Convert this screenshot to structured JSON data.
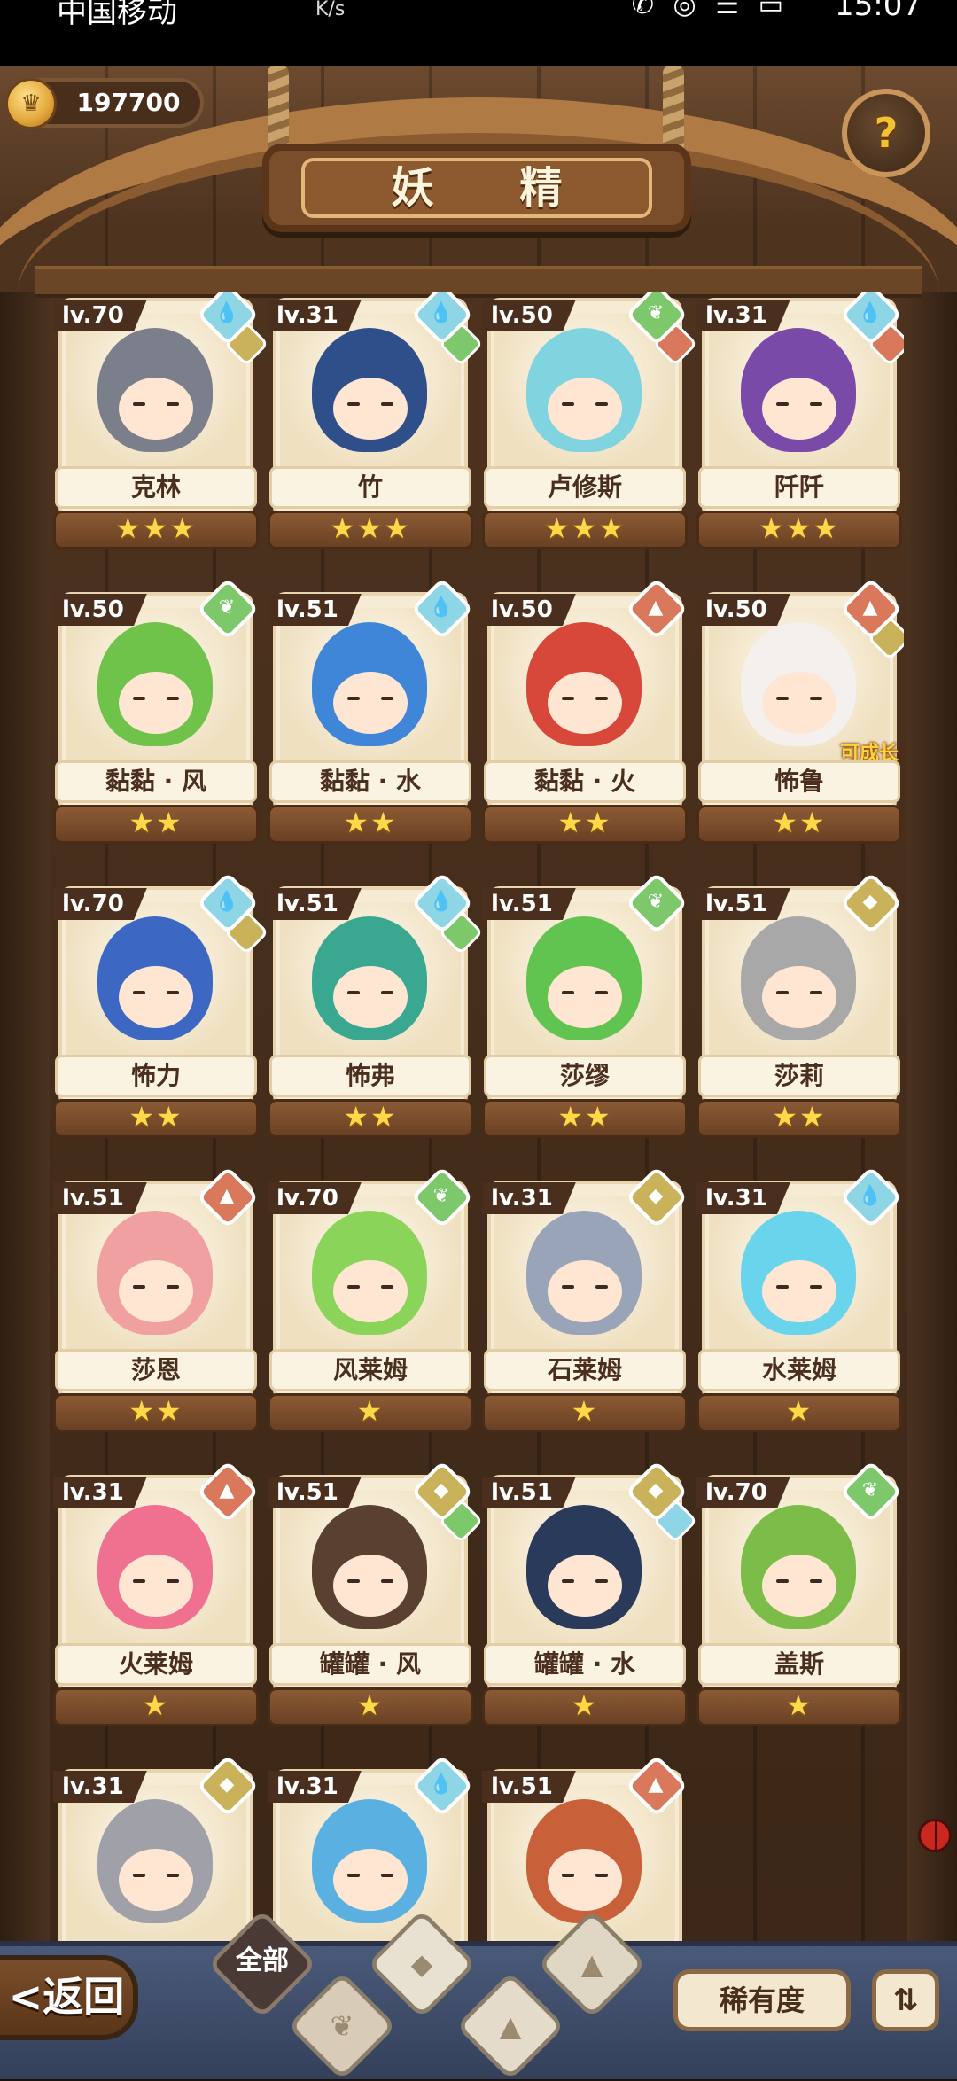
{
  "status_bar": {
    "carrier": "中国移动",
    "network": "K/s",
    "icons": "✆ ◎ ☰ ▭",
    "time": "15:07"
  },
  "header": {
    "coins": "197700",
    "title": "妖 精",
    "help_symbol": "?"
  },
  "elements": {
    "water": {
      "color": "#8ed6e6",
      "icon": "water-drop-icon",
      "symbol": "💧"
    },
    "wind": {
      "color": "#7cc86a",
      "icon": "sprout-icon",
      "symbol": "❦"
    },
    "fire": {
      "color": "#d9785a",
      "icon": "fire-icon",
      "symbol": "▲"
    },
    "earth": {
      "color": "#c9b25a",
      "icon": "rock-icon",
      "symbol": "◆"
    }
  },
  "fairies": [
    {
      "level": "lv.70",
      "name": "克林",
      "stars": "★★★",
      "el1": "water",
      "el2": "earth",
      "color": "#7b7f8c"
    },
    {
      "level": "lv.31",
      "name": "竹",
      "stars": "★★★",
      "el1": "water",
      "el2": "wind",
      "color": "#2f4f8a"
    },
    {
      "level": "lv.50",
      "name": "卢修斯",
      "stars": "★★★",
      "el1": "wind",
      "el2": "fire",
      "color": "#7fd4e0"
    },
    {
      "level": "lv.31",
      "name": "阡阡",
      "stars": "★★★",
      "el1": "water",
      "el2": "fire",
      "color": "#7a4aa8"
    },
    {
      "level": "lv.50",
      "name": "黏黏 · 风",
      "stars": "★★",
      "el1": "wind",
      "el2": "",
      "color": "#6fc24a"
    },
    {
      "level": "lv.51",
      "name": "黏黏 · 水",
      "stars": "★★",
      "el1": "water",
      "el2": "",
      "color": "#3f86d8"
    },
    {
      "level": "lv.50",
      "name": "黏黏 · 火",
      "stars": "★★",
      "el1": "fire",
      "el2": "",
      "color": "#d8483a"
    },
    {
      "level": "lv.50",
      "name": "怖鲁",
      "stars": "★★",
      "el1": "fire",
      "el2": "earth",
      "color": "#f4f0ee",
      "tag": "可成长"
    },
    {
      "level": "lv.70",
      "name": "怖力",
      "stars": "★★",
      "el1": "water",
      "el2": "earth",
      "color": "#3c68c4"
    },
    {
      "level": "lv.51",
      "name": "怖弗",
      "stars": "★★",
      "el1": "water",
      "el2": "wind",
      "color": "#3aa890"
    },
    {
      "level": "lv.51",
      "name": "莎缪",
      "stars": "★★",
      "el1": "wind",
      "el2": "",
      "color": "#62c450"
    },
    {
      "level": "lv.51",
      "name": "莎莉",
      "stars": "★★",
      "el1": "earth",
      "el2": "",
      "color": "#a8a8a8"
    },
    {
      "level": "lv.51",
      "name": "莎恩",
      "stars": "★★",
      "el1": "fire",
      "el2": "",
      "color": "#f0a0a0"
    },
    {
      "level": "lv.70",
      "name": "风莱姆",
      "stars": "★",
      "el1": "wind",
      "el2": "",
      "color": "#8ad45a"
    },
    {
      "level": "lv.31",
      "name": "石莱姆",
      "stars": "★",
      "el1": "earth",
      "el2": "",
      "color": "#9aa4b8"
    },
    {
      "level": "lv.31",
      "name": "水莱姆",
      "stars": "★",
      "el1": "water",
      "el2": "",
      "color": "#6ad4ec"
    },
    {
      "level": "lv.31",
      "name": "火莱姆",
      "stars": "★",
      "el1": "fire",
      "el2": "",
      "color": "#f07090"
    },
    {
      "level": "lv.51",
      "name": "罐罐 · 风",
      "stars": "★",
      "el1": "earth",
      "el2": "wind",
      "color": "#5a4030"
    },
    {
      "level": "lv.51",
      "name": "罐罐 · 水",
      "stars": "★",
      "el1": "earth",
      "el2": "water",
      "color": "#2a3a5a"
    },
    {
      "level": "lv.70",
      "name": "盖斯",
      "stars": "★",
      "el1": "wind",
      "el2": "",
      "color": "#7cbc48"
    },
    {
      "level": "lv.31",
      "name": "",
      "stars": "",
      "el1": "earth",
      "el2": "",
      "color": "#a0a0a8"
    },
    {
      "level": "lv.31",
      "name": "",
      "stars": "",
      "el1": "water",
      "el2": "",
      "color": "#5ab0e0"
    },
    {
      "level": "lv.51",
      "name": "",
      "stars": "",
      "el1": "fire",
      "el2": "",
      "color": "#c8603a"
    }
  ],
  "bottom_bar": {
    "back_label": "<返回",
    "filter_all_label": "全部",
    "filters": [
      {
        "name": "wind",
        "icon": "sprout-icon",
        "symbol": "❦"
      },
      {
        "name": "water",
        "icon": "water-drop-icon",
        "symbol": "◆"
      },
      {
        "name": "fire",
        "icon": "mountain-icon",
        "symbol": "▲"
      },
      {
        "name": "earth",
        "icon": "peak-icon",
        "symbol": "▲"
      }
    ],
    "sort_label": "稀有度",
    "order_symbol": "⇅"
  }
}
